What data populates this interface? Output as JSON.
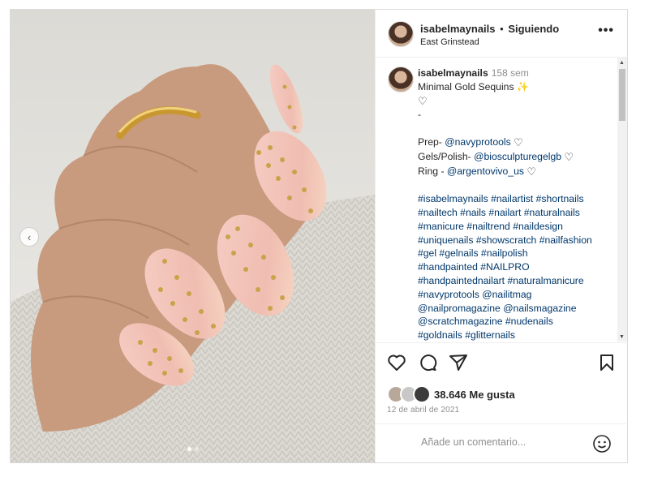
{
  "post": {
    "username": "isabelmaynails",
    "separator": "•",
    "follow_label": "Siguiendo",
    "location": "East Grinstead",
    "more_label": "•••"
  },
  "caption": {
    "username": "isabelmaynails",
    "time": "158 sem",
    "title": "Minimal Gold Sequins ✨",
    "dot": "-",
    "credits": [
      {
        "prefix": "Prep- ",
        "handle": "@navyprotools"
      },
      {
        "prefix": "Gels/Polish- ",
        "handle": "@biosculpturegelgb"
      },
      {
        "prefix": "Ring - ",
        "handle": "@argentovivo_us"
      }
    ],
    "hashtag_lines": [
      "#isabelmaynails #nailartist #shortnails",
      "#nailtech #nails #nailart #naturalnails",
      "#manicure #nailtrend #naildesign",
      "#uniquenails #showscratch #nailfashion",
      "#gel #gelnails #nailpolish",
      "#handpainted #NAILPRO",
      "#handpaintednailart #naturalmanicure",
      "#navyprotools @nailitmag",
      "@nailpromagazine @nailsmagazine",
      "@scratchmagazine #nudenails",
      "#goldnails #glitternails"
    ]
  },
  "engagement": {
    "likes": "38.646 Me gusta",
    "date": "12 de abril de 2021"
  },
  "comment_box": {
    "placeholder": "Añade un comentario..."
  },
  "icons": [
    "like-heart-icon",
    "comment-icon",
    "share-icon",
    "save-bookmark-icon",
    "emoji-icon",
    "more-options-icon",
    "carousel-prev-icon"
  ],
  "colors": {
    "link": "#00376b",
    "muted": "#8e8e8e",
    "text": "#262626",
    "nail": "#f2c2b8",
    "sequin": "#c9a24a"
  }
}
